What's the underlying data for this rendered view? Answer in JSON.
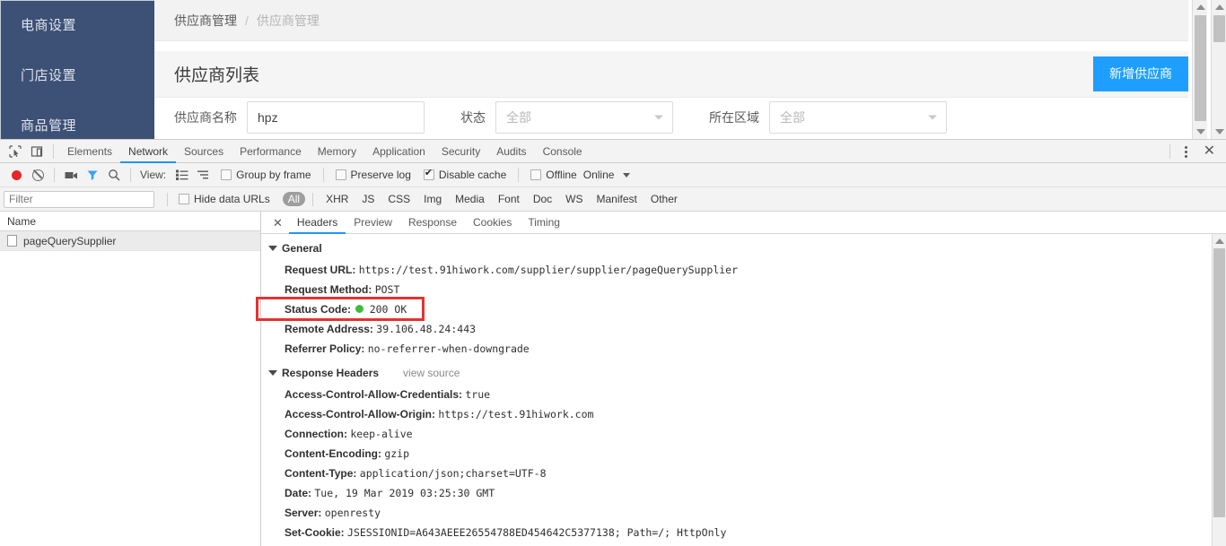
{
  "webpage": {
    "sidebar": {
      "items": [
        {
          "label": "电商设置"
        },
        {
          "label": "门店设置"
        },
        {
          "label": "商品管理"
        }
      ]
    },
    "breadcrumb": {
      "parent": "供应商管理",
      "separator": "/",
      "current": "供应商管理"
    },
    "panel": {
      "title": "供应商列表",
      "add_button": "新增供应商"
    },
    "filters": [
      {
        "label": "供应商名称",
        "type": "input",
        "value": "hpz",
        "placeholder": ""
      },
      {
        "label": "状态",
        "type": "select",
        "value": "全部"
      },
      {
        "label": "所在区域",
        "type": "select",
        "value": "全部"
      }
    ],
    "accent_color": "#1e9fff",
    "sidebar_color": "#3d5075"
  },
  "devtools": {
    "panels": [
      {
        "label": "Elements",
        "active": false
      },
      {
        "label": "Network",
        "active": true
      },
      {
        "label": "Sources",
        "active": false
      },
      {
        "label": "Performance",
        "active": false
      },
      {
        "label": "Memory",
        "active": false
      },
      {
        "label": "Application",
        "active": false
      },
      {
        "label": "Security",
        "active": false
      },
      {
        "label": "Audits",
        "active": false
      },
      {
        "label": "Console",
        "active": false
      }
    ],
    "toolbar": {
      "view_label": "View:",
      "group_by_frame": {
        "label": "Group by frame",
        "checked": false
      },
      "preserve_log": {
        "label": "Preserve log",
        "checked": false
      },
      "disable_cache": {
        "label": "Disable cache",
        "checked": true
      },
      "offline": {
        "label": "Offline",
        "checked": false
      },
      "online": {
        "label": "Online"
      }
    },
    "filterbar": {
      "filter_placeholder": "Filter",
      "filter_value": "",
      "hide_data_urls": {
        "label": "Hide data URLs",
        "checked": false
      },
      "types": [
        {
          "label": "All",
          "selected": true
        },
        {
          "label": "XHR",
          "selected": false
        },
        {
          "label": "JS",
          "selected": false
        },
        {
          "label": "CSS",
          "selected": false
        },
        {
          "label": "Img",
          "selected": false
        },
        {
          "label": "Media",
          "selected": false
        },
        {
          "label": "Font",
          "selected": false
        },
        {
          "label": "Doc",
          "selected": false
        },
        {
          "label": "WS",
          "selected": false
        },
        {
          "label": "Manifest",
          "selected": false
        },
        {
          "label": "Other",
          "selected": false
        }
      ]
    },
    "requests": {
      "column_header": "Name",
      "rows": [
        {
          "name": "pageQuerySupplier",
          "selected": true
        }
      ]
    },
    "detail_tabs": [
      {
        "label": "Headers",
        "active": true
      },
      {
        "label": "Preview",
        "active": false
      },
      {
        "label": "Response",
        "active": false
      },
      {
        "label": "Cookies",
        "active": false
      },
      {
        "label": "Timing",
        "active": false
      }
    ],
    "general": {
      "section_label": "General",
      "entries": [
        {
          "key": "Request URL:",
          "value": "https://test.91hiwork.com/supplier/supplier/pageQuerySupplier"
        },
        {
          "key": "Request Method:",
          "value": "POST"
        },
        {
          "key": "Status Code:",
          "value": "200 OK",
          "status_dot": "#3fbb3f",
          "highlighted": true
        },
        {
          "key": "Remote Address:",
          "value": "39.106.48.24:443"
        },
        {
          "key": "Referrer Policy:",
          "value": "no-referrer-when-downgrade"
        }
      ]
    },
    "response_headers": {
      "section_label": "Response Headers",
      "view_source": "view source",
      "entries": [
        {
          "key": "Access-Control-Allow-Credentials:",
          "value": "true"
        },
        {
          "key": "Access-Control-Allow-Origin:",
          "value": "https://test.91hiwork.com"
        },
        {
          "key": "Connection:",
          "value": "keep-alive"
        },
        {
          "key": "Content-Encoding:",
          "value": "gzip"
        },
        {
          "key": "Content-Type:",
          "value": "application/json;charset=UTF-8"
        },
        {
          "key": "Date:",
          "value": "Tue, 19 Mar 2019 03:25:30 GMT"
        },
        {
          "key": "Server:",
          "value": "openresty"
        },
        {
          "key": "Set-Cookie:",
          "value": "JSESSIONID=A643AEEE26554788ED454642C5377138; Path=/; HttpOnly"
        }
      ]
    },
    "annotation_color": "#e53232"
  }
}
